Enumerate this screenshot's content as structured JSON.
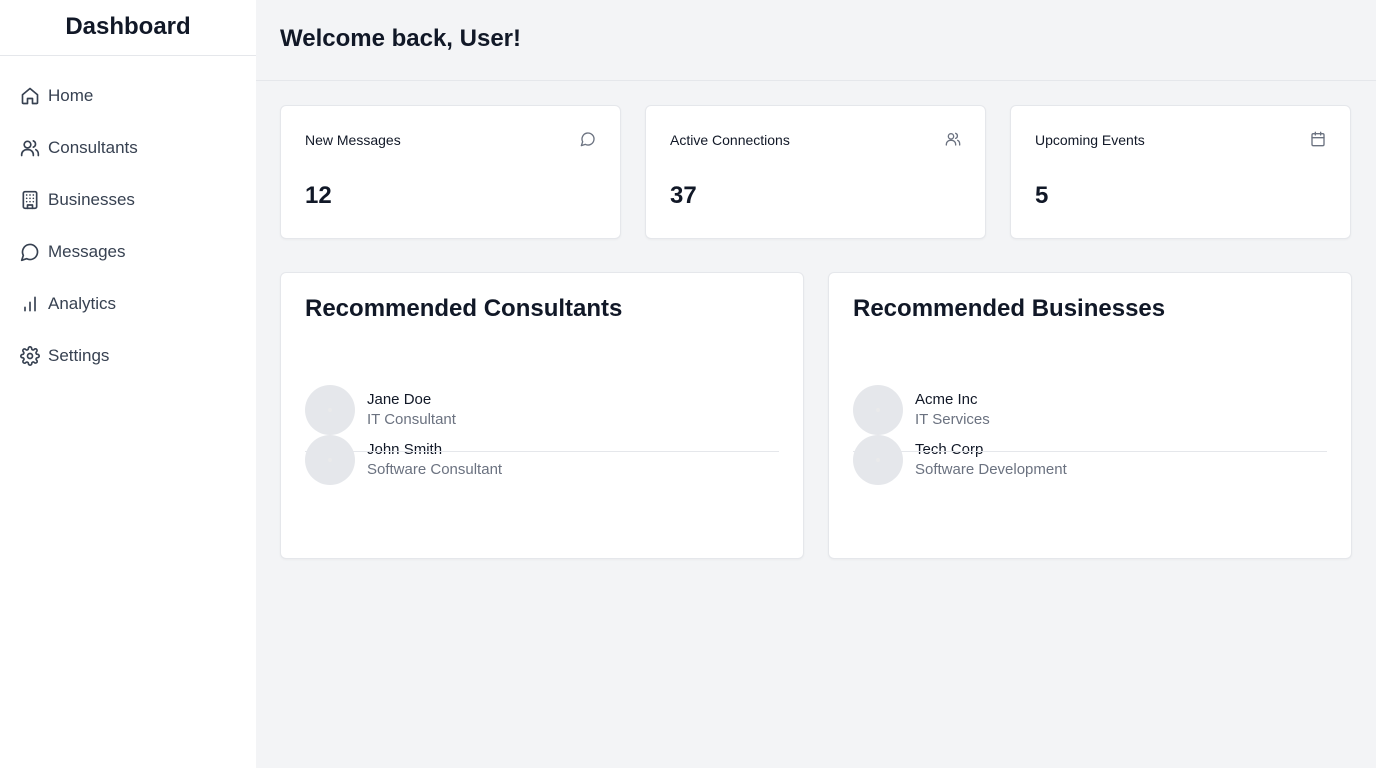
{
  "sidebar": {
    "brand": "Dashboard",
    "items": [
      {
        "label": "Home",
        "icon": "home-icon"
      },
      {
        "label": "Consultants",
        "icon": "users-icon"
      },
      {
        "label": "Businesses",
        "icon": "building-icon"
      },
      {
        "label": "Messages",
        "icon": "message-icon"
      },
      {
        "label": "Analytics",
        "icon": "bar-chart-icon"
      },
      {
        "label": "Settings",
        "icon": "gear-icon"
      }
    ]
  },
  "header": {
    "title": "Welcome back, User!"
  },
  "stats": [
    {
      "title": "New Messages",
      "value": "12",
      "icon": "message-icon"
    },
    {
      "title": "Active Connections",
      "value": "37",
      "icon": "users-icon"
    },
    {
      "title": "Upcoming Events",
      "value": "5",
      "icon": "calendar-icon"
    }
  ],
  "consultants": {
    "title": "Recommended Consultants",
    "items": [
      {
        "name": "Jane Doe",
        "role": "IT Consultant"
      },
      {
        "name": "John Smith",
        "role": "Software Consultant"
      }
    ]
  },
  "businesses": {
    "title": "Recommended Businesses",
    "items": [
      {
        "name": "Acme Inc",
        "role": "IT Services"
      },
      {
        "name": "Tech Corp",
        "role": "Software Development"
      }
    ]
  },
  "colors": {
    "background": "#f3f4f6",
    "card": "#ffffff",
    "border": "#e5e7eb",
    "text": "#111827",
    "muted": "#6b7280"
  }
}
